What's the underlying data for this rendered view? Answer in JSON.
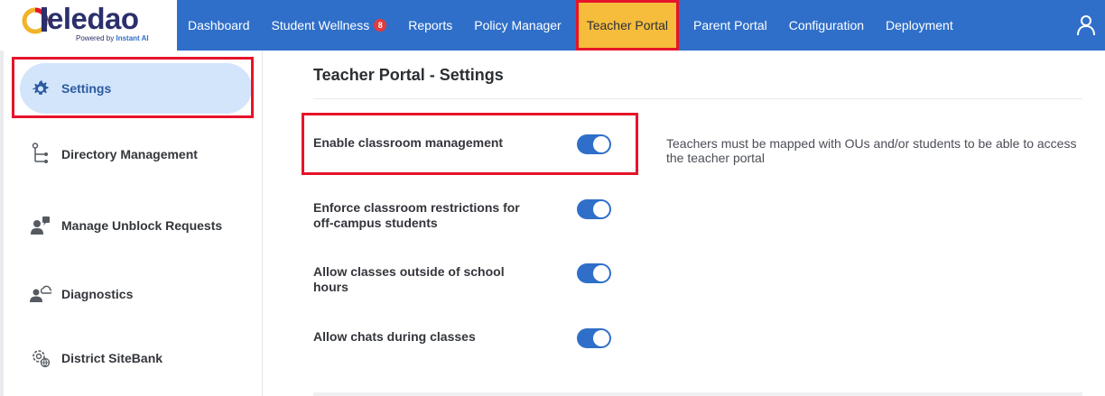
{
  "brand": {
    "name": "eledao",
    "powered_by": "Powered by",
    "powered_brand": "Instant AI"
  },
  "nav": {
    "items": [
      {
        "label": "Dashboard"
      },
      {
        "label": "Student Wellness",
        "badge": "8"
      },
      {
        "label": "Reports"
      },
      {
        "label": "Policy Manager"
      },
      {
        "label": "Teacher Portal",
        "active": true
      },
      {
        "label": "Parent Portal"
      },
      {
        "label": "Configuration"
      },
      {
        "label": "Deployment"
      }
    ],
    "user_icon": "user-icon"
  },
  "sidebar": {
    "items": [
      {
        "label": "Settings",
        "icon": "gear-icon",
        "active": true
      },
      {
        "label": "Directory Management",
        "icon": "tree-icon"
      },
      {
        "label": "Manage Unblock Requests",
        "icon": "user-request-icon"
      },
      {
        "label": "Diagnostics",
        "icon": "user-cloud-icon"
      },
      {
        "label": "District SiteBank",
        "icon": "gear-globe-icon"
      }
    ]
  },
  "content": {
    "title": "Teacher Portal - Settings",
    "settings": [
      {
        "label": "Enable classroom management",
        "enabled": true,
        "description": "Teachers must be mapped with OUs and/or students to be able to access the teacher portal"
      },
      {
        "label": "Enforce classroom restrictions for off-campus students",
        "enabled": true
      },
      {
        "label": "Allow classes outside of school hours",
        "enabled": true
      },
      {
        "label": "Allow chats during classes",
        "enabled": true
      }
    ]
  },
  "colors": {
    "header_blue": "#2f6fc9",
    "active_tab": "#f6bd3c",
    "highlight_red": "#e5142a",
    "sidebar_active": "#d2e5fb",
    "toggle_on": "#2f6fc9"
  }
}
